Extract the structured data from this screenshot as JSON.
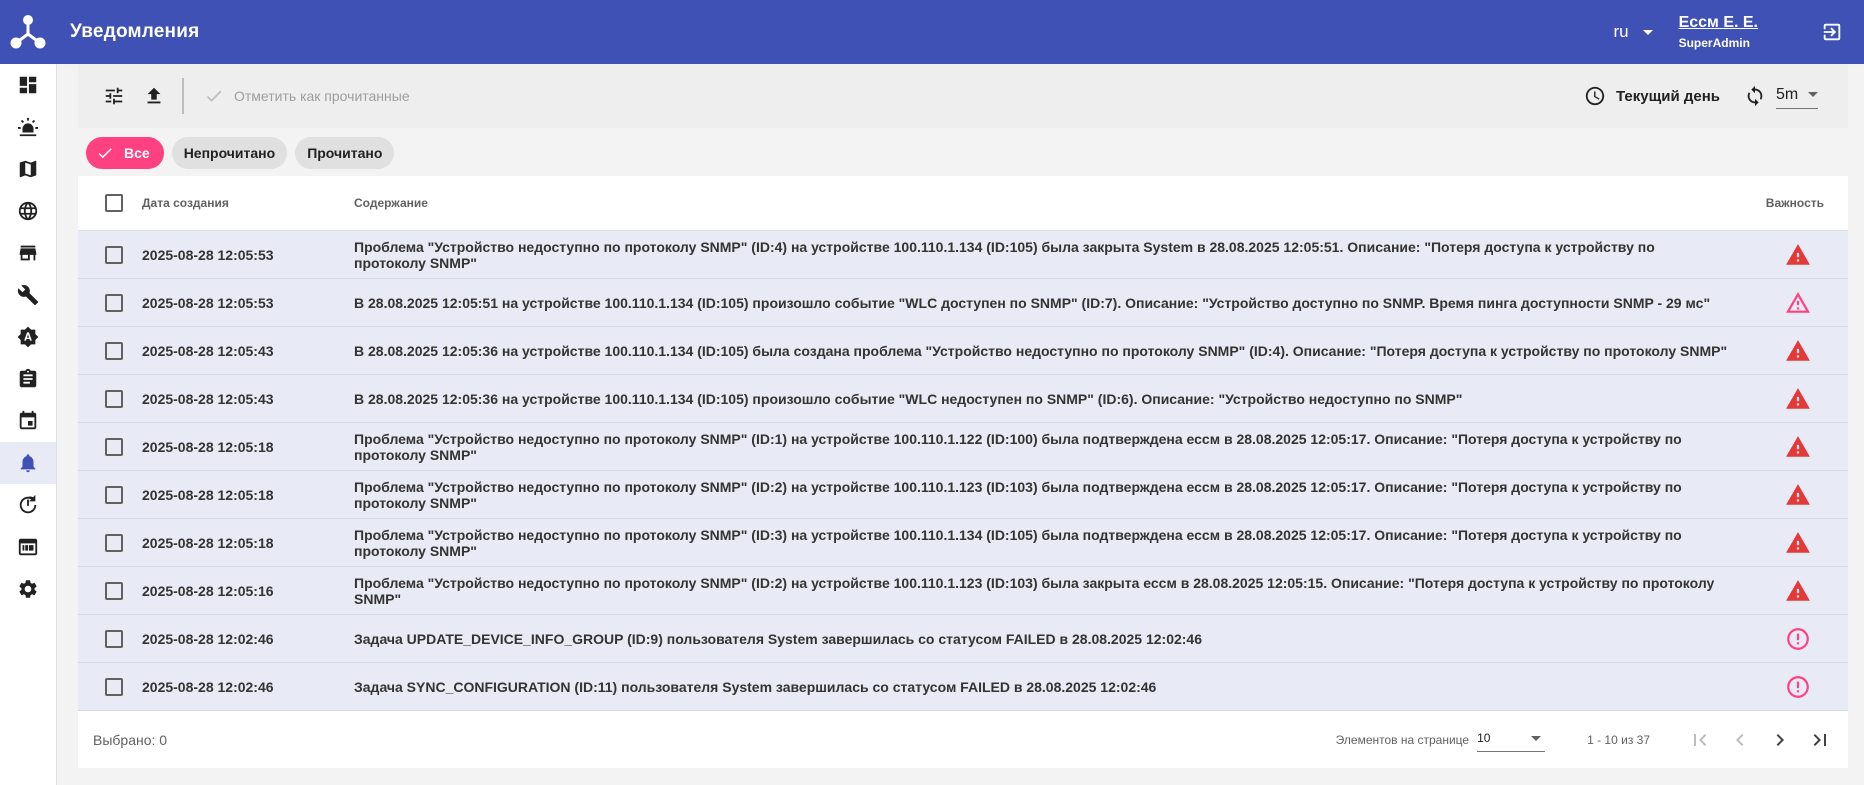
{
  "header": {
    "title": "Уведомления",
    "language": "ru",
    "user_name": "Ессм Е. Е.",
    "user_role": "SuperAdmin"
  },
  "sidebar": {
    "items": [
      {
        "name": "dashboard-icon"
      },
      {
        "name": "alarm-light-icon"
      },
      {
        "name": "map-icon"
      },
      {
        "name": "globe-icon"
      },
      {
        "name": "store-icon"
      },
      {
        "name": "wrench-icon"
      },
      {
        "name": "auto-brightness-icon"
      },
      {
        "name": "clipboard-icon"
      },
      {
        "name": "calendar-icon"
      },
      {
        "name": "bell-icon",
        "active": true
      },
      {
        "name": "power-cycle-icon"
      },
      {
        "name": "log-icon"
      },
      {
        "name": "gear-icon"
      }
    ]
  },
  "toolbar": {
    "mark_read_label": "Отметить как прочитанные",
    "period_label": "Текущий день",
    "refresh_interval": "5m"
  },
  "filters": {
    "chips": [
      {
        "label": "Все",
        "selected": true
      },
      {
        "label": "Непрочитано",
        "selected": false
      },
      {
        "label": "Прочитано",
        "selected": false
      }
    ]
  },
  "table": {
    "columns": {
      "date": "Дата создания",
      "content": "Содержание",
      "severity": "Важность"
    },
    "rows": [
      {
        "date": "2025-08-28 12:05:53",
        "content": "Проблема \"Устройство недоступно по протоколу SNMP\" (ID:4) на устройстве 100.110.1.134 (ID:105) была закрыта System в 28.08.2025 12:05:51. Описание: \"Потеря доступа к устройству по протоколу SNMP\"",
        "severity": "critical"
      },
      {
        "date": "2025-08-28 12:05:53",
        "content": "В 28.08.2025 12:05:51 на устройстве 100.110.1.134 (ID:105) произошло событие \"WLC доступен по SNMP\" (ID:7). Описание: \"Устройство доступно по SNMP. Время пинга доступности SNMP - 29 мс\"",
        "severity": "warning-outline"
      },
      {
        "date": "2025-08-28 12:05:43",
        "content": "В 28.08.2025 12:05:36 на устройстве 100.110.1.134 (ID:105) была создана проблема \"Устройство недоступно по протоколу SNMP\" (ID:4). Описание: \"Потеря доступа к устройству по протоколу SNMP\"",
        "severity": "critical"
      },
      {
        "date": "2025-08-28 12:05:43",
        "content": "В 28.08.2025 12:05:36 на устройстве 100.110.1.134 (ID:105) произошло событие \"WLC недоступен по SNMP\" (ID:6). Описание: \"Устройство недоступно по SNMP\"",
        "severity": "critical"
      },
      {
        "date": "2025-08-28 12:05:18",
        "content": "Проблема \"Устройство недоступно по протоколу SNMP\" (ID:1) на устройстве 100.110.1.122 (ID:100) была подтверждена ессм в 28.08.2025 12:05:17. Описание: \"Потеря доступа к устройству по протоколу SNMP\"",
        "severity": "critical"
      },
      {
        "date": "2025-08-28 12:05:18",
        "content": "Проблема \"Устройство недоступно по протоколу SNMP\" (ID:2) на устройстве 100.110.1.123 (ID:103) была подтверждена ессм в 28.08.2025 12:05:17. Описание: \"Потеря доступа к устройству по протоколу SNMP\"",
        "severity": "critical"
      },
      {
        "date": "2025-08-28 12:05:18",
        "content": "Проблема \"Устройство недоступно по протоколу SNMP\" (ID:3) на устройстве 100.110.1.134 (ID:105) была подтверждена ессм в 28.08.2025 12:05:17. Описание: \"Потеря доступа к устройству по протоколу SNMP\"",
        "severity": "critical"
      },
      {
        "date": "2025-08-28 12:05:16",
        "content": "Проблема \"Устройство недоступно по протоколу SNMP\" (ID:2) на устройстве 100.110.1.123 (ID:103) была закрыта ессм в 28.08.2025 12:05:15. Описание: \"Потеря доступа к устройству по протоколу SNMP\"",
        "severity": "critical"
      },
      {
        "date": "2025-08-28 12:02:46",
        "content": "Задача UPDATE_DEVICE_INFO_GROUP (ID:9) пользователя System завершилась со статусом FAILED в 28.08.2025 12:02:46",
        "severity": "error-outline"
      },
      {
        "date": "2025-08-28 12:02:46",
        "content": "Задача SYNC_CONFIGURATION (ID:11) пользователя System завершилась со статусом FAILED в 28.08.2025 12:02:46",
        "severity": "error-outline"
      }
    ]
  },
  "footer": {
    "selected_label": "Выбрано: 0",
    "page_size_label": "Элементов на странице",
    "page_size": "10",
    "range_label": "1 - 10 из 37"
  },
  "colors": {
    "primary": "#3f51b5",
    "accent": "#ff4081",
    "severity_critical": "#e53935",
    "severity_warning": "#ff4081",
    "row_bg": "#e8eaf6"
  }
}
